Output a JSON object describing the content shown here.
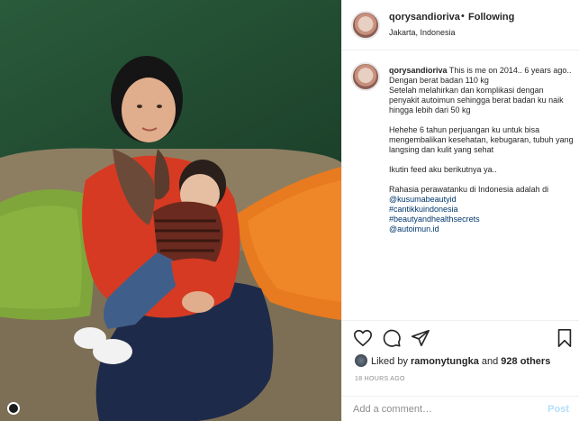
{
  "photo": {
    "alt_subject": "woman-holding-baby"
  },
  "post": {
    "username": "qorysandioriva",
    "separator": "•",
    "follow_status": "Following",
    "location": "Jakarta, Indonesia"
  },
  "caption": {
    "username": "qorysandioriva",
    "intro": " This is me on 2014.. 6 years ago..",
    "line2": "Dengan berat badan 110 kg",
    "line3": "Setelah melahirkan dan komplikasi dengan penyakit autoimun sehingga berat badan ku naik hingga lebih dari 50 kg",
    "para2": "Hehehe 6 tahun perjuangan ku untuk bisa mengembalikan kesehatan, kebugaran, tubuh yang langsing dan kulit yang sehat",
    "para3": "Ikutin feed aku berikutnya ya..",
    "para4": "Rahasia perawatanku di Indonesia adalah di ",
    "mention1": "@kusumabeautyid",
    "tag1": "#cantikkuindonesia",
    "tag2": "#beautyandhealthsecrets",
    "mention2": "@autoimun.id"
  },
  "actions": {
    "icons": [
      "heart-icon",
      "comment-icon",
      "share-icon",
      "bookmark-icon"
    ]
  },
  "likes": {
    "prefix": "Liked by ",
    "user": "ramonytungka",
    "middle": " and ",
    "others": "928 others"
  },
  "timestamp": "18 HOURS AGO",
  "comment": {
    "placeholder": "Add a comment…",
    "post_label": "Post"
  },
  "colors": {
    "link": "#00376b",
    "post_disabled": "#b2dffc",
    "muted": "#8e8e8e",
    "border": "#efefef"
  }
}
